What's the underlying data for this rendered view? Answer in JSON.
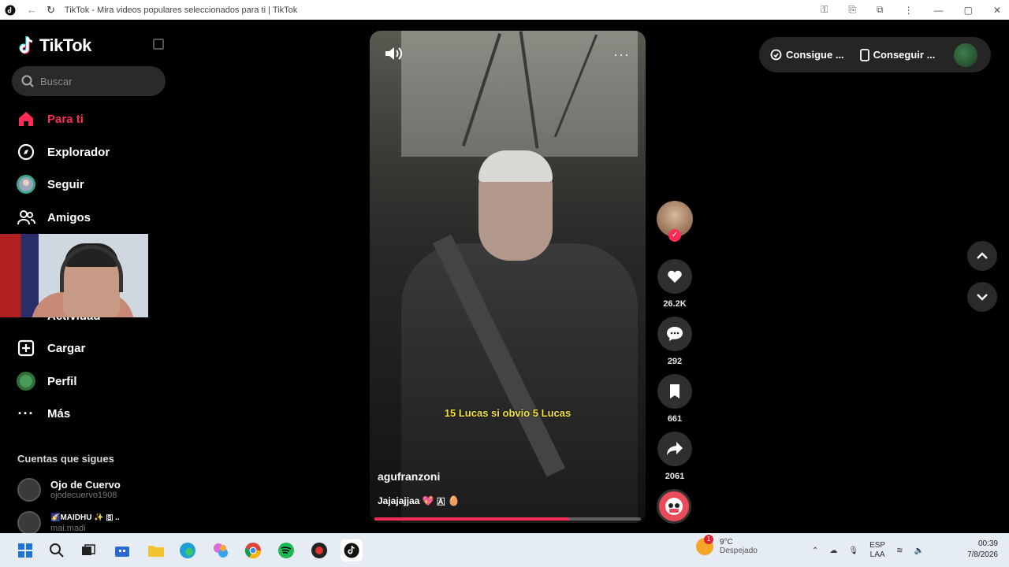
{
  "browser": {
    "title": "TikTok - Mira videos populares seleccionados para ti | TikTok"
  },
  "sidebar": {
    "logo_text": "TikTok",
    "search_placeholder": "Buscar",
    "items": [
      {
        "label": "Para ti",
        "icon": "home-icon",
        "active": true
      },
      {
        "label": "Explorador",
        "icon": "compass-icon",
        "active": false
      },
      {
        "label": "Seguir",
        "icon": "following-avatar-icon",
        "active": false
      },
      {
        "label": "Amigos",
        "icon": "friends-icon",
        "active": false
      },
      {
        "label": "Actividad",
        "icon": "activity-icon",
        "active": false
      },
      {
        "label": "Cargar",
        "icon": "upload-icon",
        "active": false
      },
      {
        "label": "Perfil",
        "icon": "profile-avatar-icon",
        "active": false
      },
      {
        "label": "Más",
        "icon": "more-icon",
        "active": false
      }
    ],
    "following_title": "Cuentas que sigues",
    "accounts": [
      {
        "name": "Ojo de Cuervo",
        "handle": "ojodecuervo1908"
      },
      {
        "name": "🌠MAIDHU ✨ 🇸 ..",
        "handle": "mai.madi"
      }
    ]
  },
  "video": {
    "caption": "15 Lucas si obvio 5 Lucas",
    "author": "agufranzoni",
    "description": "Jajajajjaa 💖 🇦 🥚",
    "progress": 0.73
  },
  "actions": {
    "likes": "26.2K",
    "comments": "292",
    "saves": "661",
    "shares": "2061"
  },
  "topbar": {
    "coins_label": "Consigue ...",
    "app_label": "Conseguir ..."
  },
  "taskbar": {
    "weather_temp": "9°C",
    "weather_desc": "Despejado",
    "weather_badge": "1",
    "lang_top": "ESP",
    "lang_bottom": "LAA",
    "time": "00:39",
    "date": "7/8/2026"
  },
  "colors": {
    "accent": "#fe2c55",
    "caption": "#f2e23a"
  }
}
